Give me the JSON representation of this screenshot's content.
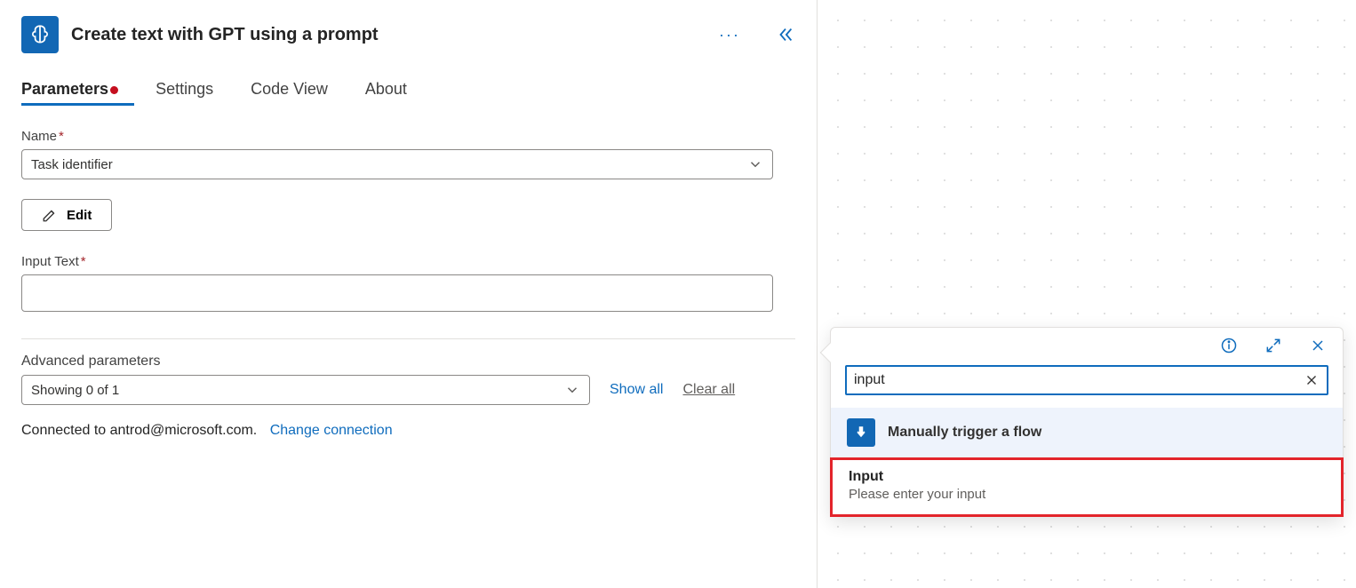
{
  "panel": {
    "title": "Create text with GPT using a prompt"
  },
  "tabs": {
    "parameters": "Parameters",
    "settings": "Settings",
    "codeview": "Code View",
    "about": "About"
  },
  "fields": {
    "name_label": "Name",
    "name_value": "Task identifier",
    "edit_label": "Edit",
    "input_text_label": "Input Text",
    "input_text_value": ""
  },
  "advanced": {
    "label": "Advanced parameters",
    "summary": "Showing 0 of 1",
    "showall": "Show all",
    "clearall": "Clear all"
  },
  "connection": {
    "prefix": "Connected to ",
    "account": "antrod@microsoft.com.",
    "change": "Change connection"
  },
  "popup": {
    "search_value": "input",
    "category": "Manually trigger a flow",
    "result_title": "Input",
    "result_desc": "Please enter your input"
  }
}
